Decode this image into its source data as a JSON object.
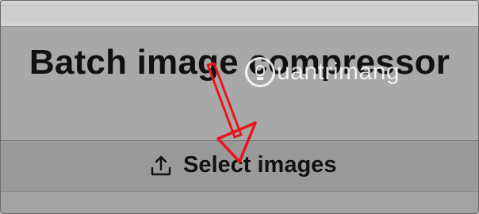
{
  "app": {
    "title": "Batch image compressor"
  },
  "actions": {
    "select_images_label": "Select images",
    "select_images_icon": "upload-icon"
  },
  "watermark": {
    "text": "uantrimang",
    "icon": "lightbulb-icon"
  },
  "colors": {
    "annotation_arrow": "#e8161c",
    "title_text": "#111111",
    "panel_bg": "#a8a8a8"
  }
}
